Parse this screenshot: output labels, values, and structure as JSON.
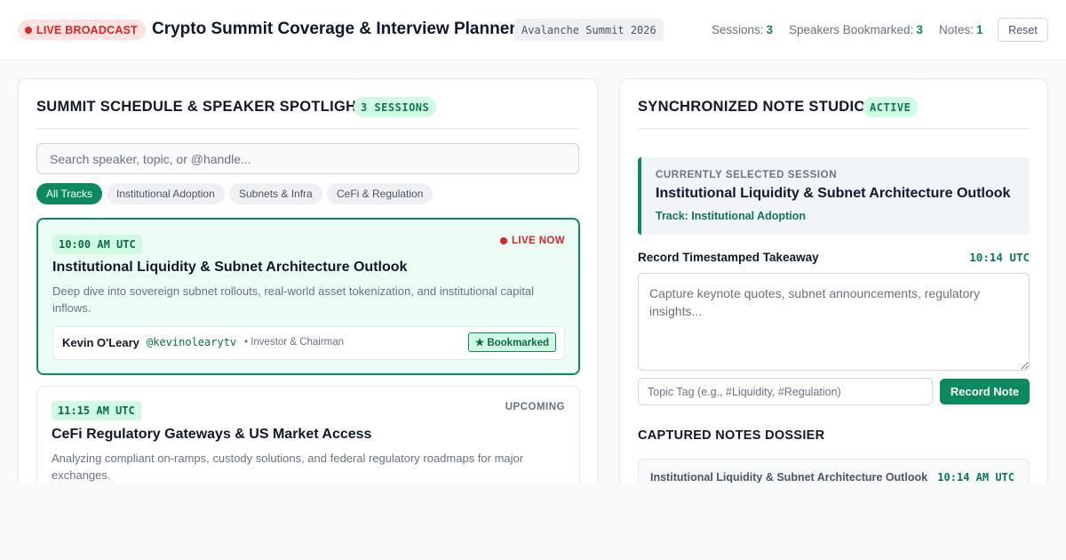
{
  "header": {
    "live_label": "LIVE BROADCAST",
    "title": "Crypto Summit Coverage & Interview Planner",
    "event_tag": "Avalanche Summit 2026",
    "stats": [
      {
        "label": "Sessions:",
        "value": "3"
      },
      {
        "label": "Speakers Bookmarked:",
        "value": "3"
      },
      {
        "label": "Notes:",
        "value": "1"
      }
    ],
    "reset_label": "Reset"
  },
  "schedule": {
    "title": "SUMMIT SCHEDULE & SPEAKER SPOTLIGHT",
    "badge": "3 SESSIONS",
    "search_placeholder": "Search speaker, topic, or @handle...",
    "filters": [
      {
        "label": "All Tracks",
        "active": true
      },
      {
        "label": "Institutional Adoption",
        "active": false
      },
      {
        "label": "Subnets & Infra",
        "active": false
      },
      {
        "label": "CeFi & Regulation",
        "active": false
      }
    ],
    "sessions": [
      {
        "time": "10:00 AM UTC",
        "status": "LIVE NOW",
        "title": "Institutional Liquidity & Subnet Architecture Outlook",
        "description": "Deep dive into sovereign subnet rollouts, real-world asset tokenization, and institutional capital inflows.",
        "speaker": {
          "name": "Kevin O'Leary",
          "handle": "@kevinolearytv",
          "role": "• Investor & Chairman",
          "bookmark_label": "★ Bookmarked"
        }
      },
      {
        "time": "11:15 AM UTC",
        "status": "UPCOMING",
        "title": "CeFi Regulatory Gateways & US Market Access",
        "description": "Analyzing compliant on-ramps, custody solutions, and federal regulatory roadmaps for major exchanges."
      }
    ]
  },
  "notes": {
    "title": "SYNCHRONIZED NOTE STUDIO",
    "badge": "ACTIVE",
    "selected": {
      "label": "CURRENTLY SELECTED SESSION",
      "title": "Institutional Liquidity & Subnet Architecture Outlook",
      "track": "Track: Institutional Adoption"
    },
    "record_label": "Record Timestamped Takeaway",
    "record_time": "10:14 UTC",
    "textarea_placeholder": "Capture keynote quotes, subnet announcements, regulatory insights...",
    "topic_placeholder": "Topic Tag (e.g., #Liquidity, #Regulation)",
    "record_button": "Record Note",
    "dossier_title": "CAPTURED NOTES DOSSIER",
    "captured": [
      {
        "session": "Institutional Liquidity & Subnet Architecture Outlook",
        "time": "10:14 AM UTC"
      }
    ]
  },
  "colors": {
    "accent": "#0b8a5f",
    "live": "#dc2626",
    "badge_bg": "#d1fae5"
  }
}
